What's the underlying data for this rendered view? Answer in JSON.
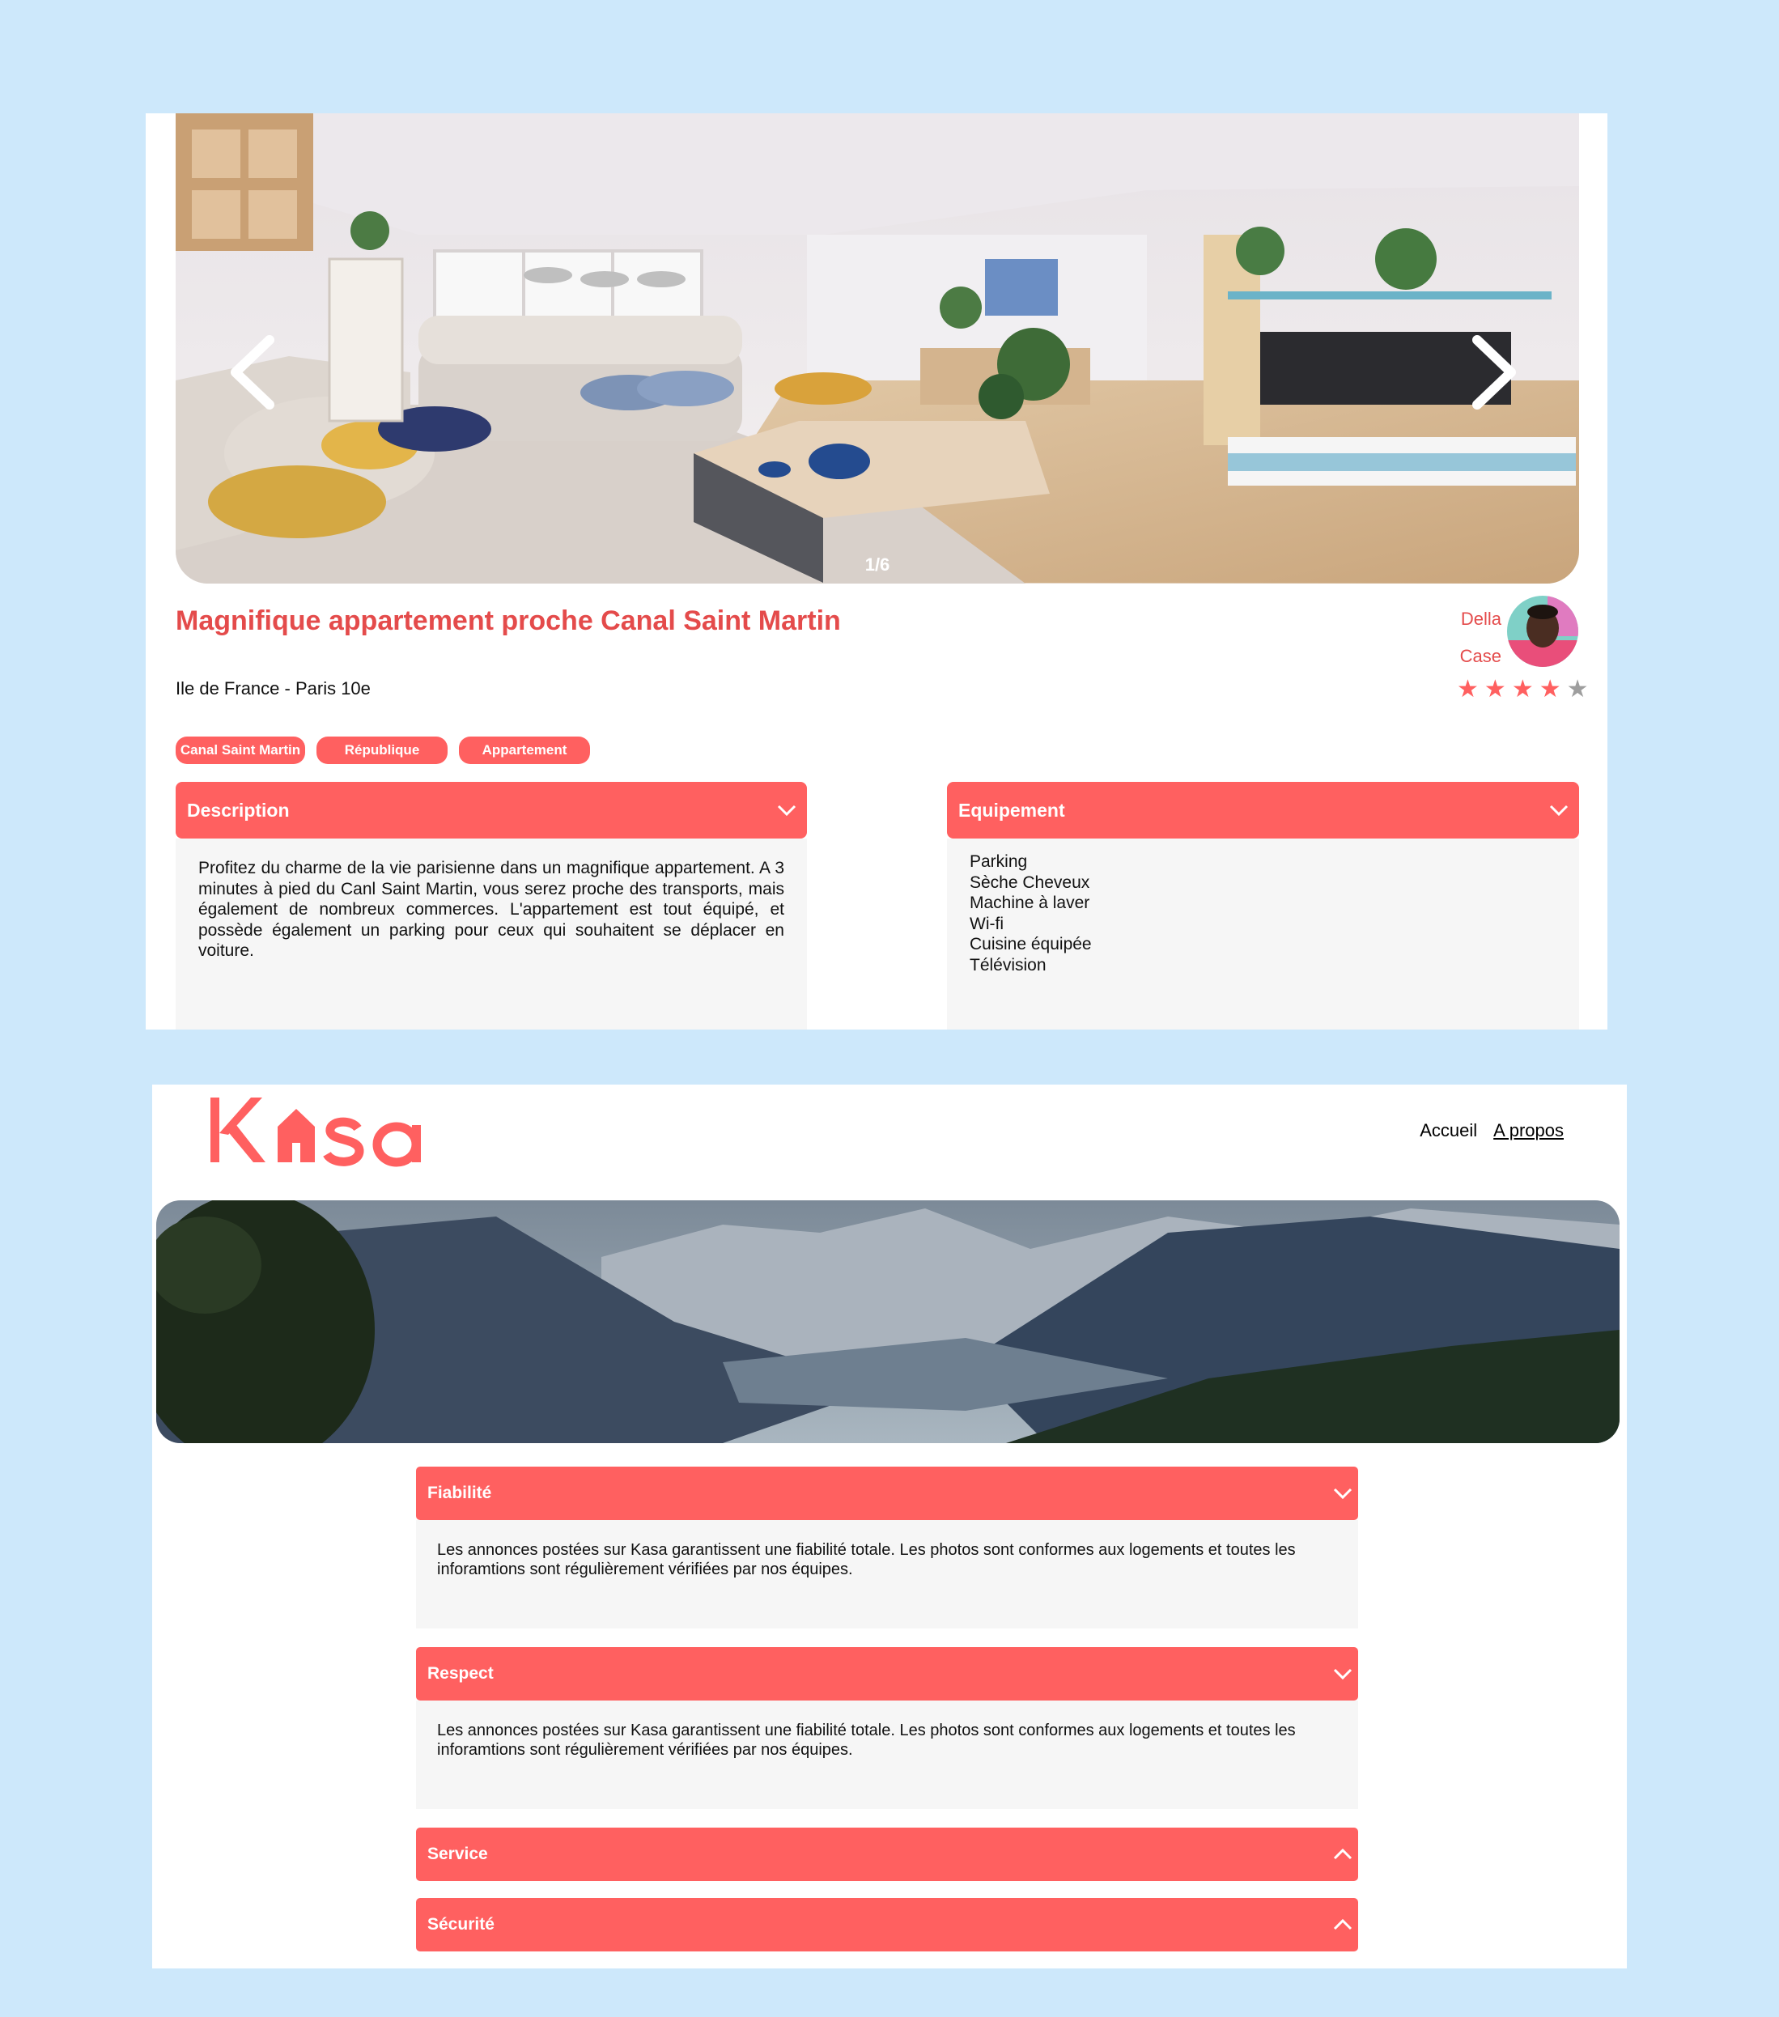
{
  "listing": {
    "carousel": {
      "counter": "1/6",
      "prev_icon": "chevron-left-icon",
      "next_icon": "chevron-right-icon"
    },
    "title": "Magnifique appartement proche Canal Saint Martin",
    "location": "Ile de France - Paris 10e",
    "host": {
      "first_name": "Della",
      "last_name": "Case"
    },
    "rating": {
      "value": 4,
      "max": 5,
      "active_color": "#ff6060",
      "inactive_color": "#9e9e9e"
    },
    "tags": [
      "Canal Saint Martin",
      "République",
      "Appartement"
    ],
    "description": {
      "title": "Description",
      "text": "Profitez du charme de la vie parisienne dans un magnifique appartement. A 3 minutes à pied du Canl Saint Martin, vous serez proche des transports, mais également de nombreux commerces. L'appartement est tout équipé, et possède également un parking pour ceux qui souhaitent se déplacer en voiture."
    },
    "equipment": {
      "title": "Equipement",
      "items": [
        "Parking",
        "Sèche Cheveux",
        "Machine à laver",
        "Wi-fi",
        "Cuisine équipée",
        "Télévision"
      ]
    }
  },
  "about": {
    "logo_text": "Kasa",
    "nav": [
      "Accueil",
      "A propos"
    ],
    "accordions": [
      {
        "title": "Fiabilité",
        "open": true,
        "text": "Les annonces postées sur Kasa garantissent une fiabilité totale. Les photos sont conformes aux logements et toutes les inforamtions sont régulièrement vérifiées par nos équipes."
      },
      {
        "title": "Respect",
        "open": true,
        "text": "Les annonces postées sur Kasa garantissent une fiabilité totale. Les photos sont conformes aux logements et toutes les inforamtions sont régulièrement vérifiées par nos équipes."
      },
      {
        "title": "Service",
        "open": false
      },
      {
        "title": "Sécurité",
        "open": false
      }
    ]
  },
  "colors": {
    "brand": "#ff6060",
    "background": "#cde8fb"
  }
}
